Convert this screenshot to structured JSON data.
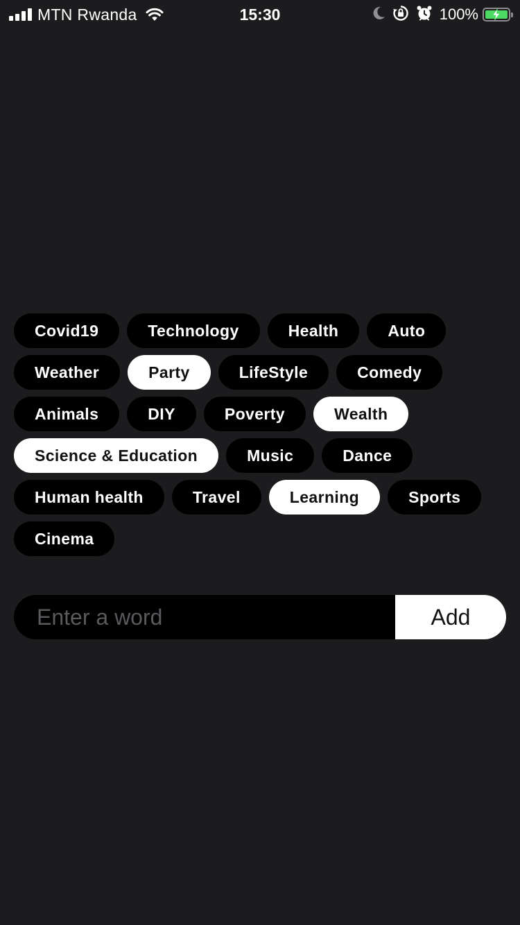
{
  "status_bar": {
    "carrier": "MTN Rwanda",
    "time": "15:30",
    "battery_percent": "100%",
    "signal_icon": "cellular-signal-icon",
    "wifi_icon": "wifi-icon",
    "icons": [
      "moon-icon",
      "orientation-lock-icon",
      "alarm-icon",
      "battery-charging-icon"
    ],
    "battery_color": "#4cd964"
  },
  "tags": [
    {
      "label": "Covid19",
      "selected": false
    },
    {
      "label": "Technology",
      "selected": false
    },
    {
      "label": "Health",
      "selected": false
    },
    {
      "label": "Auto",
      "selected": false
    },
    {
      "label": "Weather",
      "selected": false
    },
    {
      "label": "Party",
      "selected": true
    },
    {
      "label": "LifeStyle",
      "selected": false
    },
    {
      "label": "Comedy",
      "selected": false
    },
    {
      "label": "Animals",
      "selected": false
    },
    {
      "label": "DIY",
      "selected": false
    },
    {
      "label": "Poverty",
      "selected": false
    },
    {
      "label": "Wealth",
      "selected": true
    },
    {
      "label": "Science & Education",
      "selected": true
    },
    {
      "label": "Music",
      "selected": false
    },
    {
      "label": "Dance",
      "selected": false
    },
    {
      "label": "Human health",
      "selected": false
    },
    {
      "label": "Travel",
      "selected": false
    },
    {
      "label": "Learning",
      "selected": true
    },
    {
      "label": "Sports",
      "selected": false
    },
    {
      "label": "Cinema",
      "selected": false
    }
  ],
  "word_input": {
    "value": "",
    "placeholder": "Enter a word"
  },
  "add_button": {
    "label": "Add"
  },
  "colors": {
    "background": "#1c1c1e",
    "tag_unselected": "#000000",
    "tag_selected": "#ffffff"
  }
}
